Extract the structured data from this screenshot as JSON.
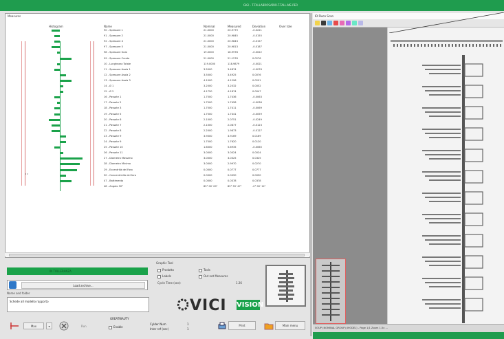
{
  "titlebar": {
    "title": "GIGI - T-TALLABROSARIO-T-TALL-ME-PER"
  },
  "measures": {
    "caption": "Measures",
    "headers": {
      "histogram": "Histogram",
      "name": "Name",
      "nominal": "Nominal",
      "measured": "Measured",
      "deviation": "Deviation",
      "over_tolerance": "Over tole"
    },
    "rows": [
      {
        "name": "90 - Spessore 1",
        "nominal": "21.0000",
        "measured": "20.9779",
        "deviation": "-0.0221",
        "bar": -3
      },
      {
        "name": "91 - Spessore 2",
        "nominal": "21.0000",
        "measured": "20.9845",
        "deviation": "-0.0155",
        "bar": -2
      },
      {
        "name": "92 - Spessore 4",
        "nominal": "21.0000",
        "measured": "20.9843",
        "deviation": "-0.0157",
        "bar": -2
      },
      {
        "name": "97 - Spessore 5",
        "nominal": "21.0000",
        "measured": "20.9813",
        "deviation": "-0.0187",
        "bar": -3
      },
      {
        "name": "98 - Spessore Gola",
        "nominal": "19.0000",
        "measured": "18.9978",
        "deviation": "-0.0022",
        "bar": -1
      },
      {
        "name": "99 - Spessore Cresta",
        "nominal": "21.0000",
        "measured": "21.1276",
        "deviation": "0.0276",
        "bar": 4
      },
      {
        "name": "10 - Lunghezza Totale",
        "nominal": "119.0000",
        "measured": "118.9879",
        "deviation": "-0.0021",
        "bar": -1
      },
      {
        "name": "11 - Spessore Asola 1",
        "nominal": "3.5000",
        "measured": "3.4874",
        "deviation": "-0.0076",
        "bar": -2
      },
      {
        "name": "12 - Spessore Asola 2",
        "nominal": "3.5000",
        "measured": "3.4925",
        "deviation": "0.0076",
        "bar": 2
      },
      {
        "name": "13 - Spessore Asola 3",
        "nominal": "4.1000",
        "measured": "4.1296",
        "deviation": "0.0291",
        "bar": 4
      },
      {
        "name": "14 - Ø 1",
        "nominal": "3.2000",
        "measured": "3.2032",
        "deviation": "0.0052",
        "bar": 1
      },
      {
        "name": "15 - Ø 2",
        "nominal": "4.1750",
        "measured": "4.1874",
        "deviation": "0.0047",
        "bar": 1
      },
      {
        "name": "16 - Passate 1",
        "nominal": "1.7500",
        "measured": "1.7436",
        "deviation": "-0.0063",
        "bar": -2
      },
      {
        "name": "17 - Passate 2",
        "nominal": "1.7500",
        "measured": "1.7458",
        "deviation": "-0.0036",
        "bar": -1
      },
      {
        "name": "18 - Passate 3",
        "nominal": "1.7500",
        "measured": "1.7411",
        "deviation": "-0.0069",
        "bar": -2
      },
      {
        "name": "19 - Passate 5",
        "nominal": "1.7500",
        "measured": "1.7441",
        "deviation": "-0.0059",
        "bar": -2
      },
      {
        "name": "20 - Passate 6",
        "nominal": "2.1000",
        "measured": "2.0751",
        "deviation": "-0.0249",
        "bar": -4
      },
      {
        "name": "21 - Passate 7",
        "nominal": "2.1000",
        "measured": "2.0877",
        "deviation": "-0.0123",
        "bar": -3
      },
      {
        "name": "22 - Passate 8",
        "nominal": "2.2000",
        "measured": "1.9873",
        "deviation": "-0.0127",
        "bar": -3
      },
      {
        "name": "23 - Passate 9",
        "nominal": "3.9000",
        "measured": "3.9169",
        "deviation": "0.0169",
        "bar": 2
      },
      {
        "name": "24 - Passate 9",
        "nominal": "1.7500",
        "measured": "1.7620",
        "deviation": "0.0120",
        "bar": 2
      },
      {
        "name": "25 - Passate 10",
        "nominal": "1.6000",
        "measured": "5.6935",
        "deviation": "-0.0065",
        "bar": -2
      },
      {
        "name": "26 - Passate 11",
        "nominal": "3.0000",
        "measured": "3.0024",
        "deviation": "0.0024",
        "bar": 1
      },
      {
        "name": "27 - Diametro Massimo",
        "nominal": "3.0000",
        "measured": "3.0325",
        "deviation": "0.0325",
        "bar": 8
      },
      {
        "name": "28 - Diametro Minimo",
        "nominal": "3.0000",
        "measured": "2.9970",
        "deviation": "0.0270",
        "bar": 7
      },
      {
        "name": "29 - Eccentrità del Foro",
        "nominal": "0.0000",
        "measured": "0.0777",
        "deviation": "0.0777",
        "bar": 6
      },
      {
        "name": "30 - Concentricità del foro",
        "nominal": "0.0000",
        "measured": "0.0090",
        "deviation": "0.0090",
        "bar": 2
      },
      {
        "name": "47 - Battimento",
        "nominal": "0.0000",
        "measured": "0.0378",
        "deviation": "0.0378",
        "bar": 4
      },
      {
        "name": "48 - Angolo 90°",
        "nominal": "89° 00' 00\"",
        "measured": "89° 59' 47\"",
        "deviation": "-0° 00' 12\"",
        "bar": 0
      }
    ]
  },
  "status": {
    "label": "IN TOLLERANZA"
  },
  "load": {
    "button": "Load archive..."
  },
  "part_name": {
    "label": "Name and folder",
    "value": "Schede all modello rapporto"
  },
  "graph": {
    "caption": "Graphic Tool",
    "rows": [
      {
        "left": "Prodotto",
        "right": "Tools"
      },
      {
        "left": "Labels",
        "right": "Out not Measures"
      }
    ],
    "cycle_label": "Cycle Time (sec):",
    "cycle_value": "1.26"
  },
  "logo": {
    "text": "VICI",
    "badge": "VISION"
  },
  "bottom": {
    "max_label": "Max",
    "mode_label": "Run",
    "section_title": "GREATWAUTY",
    "enable_label": "Enable",
    "number_label": "Cylder Num",
    "number_value": "1",
    "interval_label": "Inter ref (sec)",
    "interval_value": "1",
    "print_label": "Print",
    "open_label": "Main menu"
  },
  "viewer": {
    "caption": "ID Piece Scan",
    "status_text": "SOUP (NOMINAL GROUP) (MODEL) - Page 1/1  Zoom 1.5x  ..."
  },
  "colors": {
    "accent": "#1aa24a",
    "title": "#1f9c4e",
    "tolerance_line": "#e7a0a0"
  }
}
